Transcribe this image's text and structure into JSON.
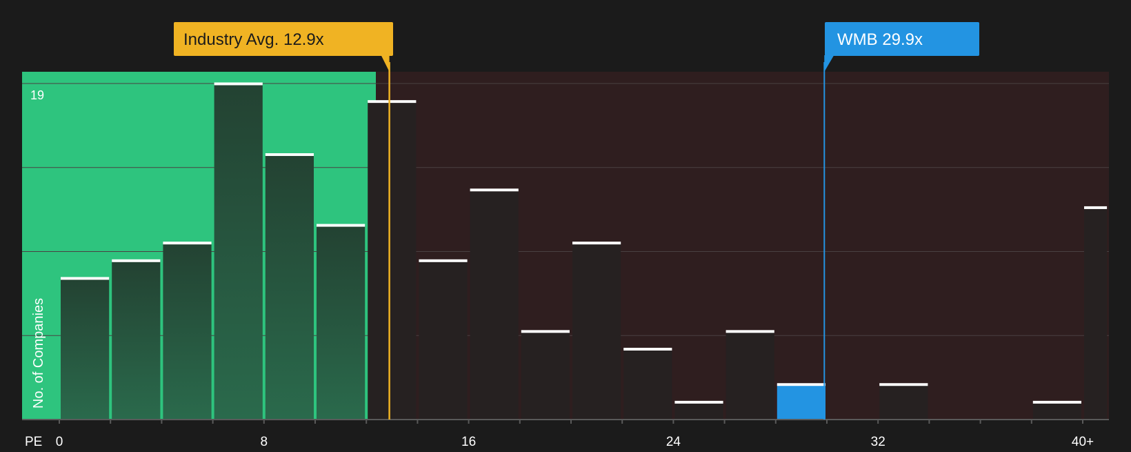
{
  "chart_data": {
    "type": "bar",
    "xlabel": "PE",
    "ylabel": "No. of Companies",
    "y_max_label": "19",
    "x_ticks": [
      "0",
      "8",
      "16",
      "24",
      "32",
      "40+"
    ],
    "ylim": [
      0,
      19
    ],
    "bins": [
      {
        "x0": 0,
        "x1": 2,
        "value": 8
      },
      {
        "x0": 2,
        "x1": 4,
        "value": 9
      },
      {
        "x0": 4,
        "x1": 6,
        "value": 10
      },
      {
        "x0": 6,
        "x1": 8,
        "value": 19
      },
      {
        "x0": 8,
        "x1": 10,
        "value": 15
      },
      {
        "x0": 10,
        "x1": 12,
        "value": 11
      },
      {
        "x0": 12,
        "x1": 14,
        "value": 18
      },
      {
        "x0": 14,
        "x1": 16,
        "value": 9
      },
      {
        "x0": 16,
        "x1": 18,
        "value": 13
      },
      {
        "x0": 18,
        "x1": 20,
        "value": 5
      },
      {
        "x0": 20,
        "x1": 22,
        "value": 10
      },
      {
        "x0": 22,
        "x1": 24,
        "value": 4
      },
      {
        "x0": 24,
        "x1": 26,
        "value": 1
      },
      {
        "x0": 26,
        "x1": 28,
        "value": 5
      },
      {
        "x0": 28,
        "x1": 30,
        "value": 2,
        "highlight": true
      },
      {
        "x0": 32,
        "x1": 34,
        "value": 2
      },
      {
        "x0": 38,
        "x1": 40,
        "value": 1
      },
      {
        "x0": 40,
        "x1": 41,
        "value": 12
      }
    ],
    "industry_avg": {
      "label": "Industry Avg. 12.9x",
      "value": 12.9,
      "color": "#f0b323"
    },
    "company": {
      "label": "WMB 29.9x",
      "value": 29.9,
      "color": "#2394e2"
    },
    "colors": {
      "background": "#1b1b1b",
      "below_zone": "#2ec47e",
      "above_zone": "#2f1e1f",
      "bar_low": "#2a6a4c",
      "bar_high": "#234232",
      "bar_dark": "#262121",
      "bar_cap": "#ffffff",
      "grid": "#4a4142"
    }
  }
}
